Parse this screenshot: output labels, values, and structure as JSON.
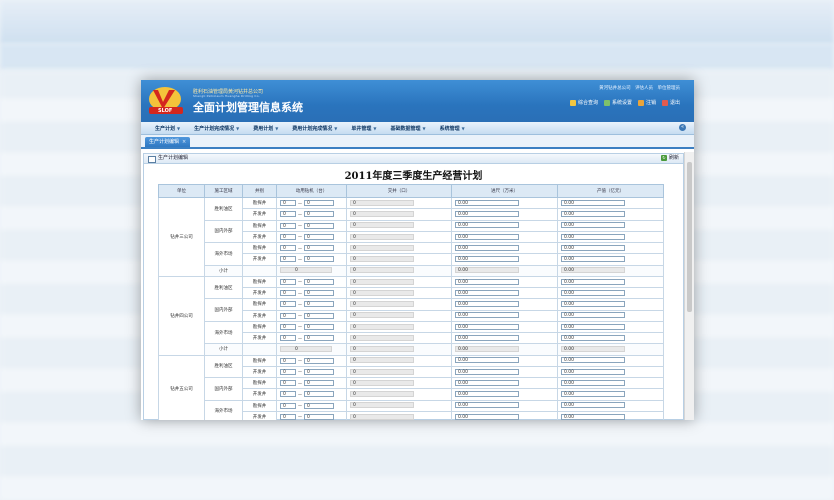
{
  "header": {
    "logo_text": "SLOF",
    "company_name": "胜利石油管理局黄河钻井总公司",
    "company_name_en": "Shengli Petroleum Huanghe Drilling Co.",
    "system_title": "全面计划管理信息系统",
    "user_info": [
      "黄河钻井总公司",
      "评估人员",
      "单位管理员"
    ],
    "tools": [
      {
        "label": "综合查询",
        "icon": "search-icon",
        "color": "#f2c640"
      },
      {
        "label": "系统设置",
        "icon": "gear-icon",
        "color": "#7ec16a"
      },
      {
        "label": "注销",
        "icon": "logout-icon",
        "color": "#e9a43a"
      },
      {
        "label": "退出",
        "icon": "exit-icon",
        "color": "#e25b4f"
      }
    ]
  },
  "nav": {
    "items": [
      "生产计划",
      "生产计划完成情况",
      "费用计划",
      "费用计划完成情况",
      "单井管理",
      "基础数据管理",
      "系统管理"
    ]
  },
  "tab": {
    "label": "生产计划编辑",
    "close": "×"
  },
  "panel": {
    "title": "生产计划编辑",
    "refresh_label": "刷新"
  },
  "report": {
    "title": "2011年度三季度生产经营计划",
    "columns": [
      "单位",
      "施工区域",
      "井别",
      "动用钻机（台）",
      "交井（口）",
      "进尺（万米）",
      "产值（亿元）"
    ],
    "units": [
      {
        "name": "钻井三公司",
        "areas": [
          {
            "name": "胜利油区",
            "rows": [
              {
                "type": "勘探井",
                "rig_min": "0",
                "rig_max": "0",
                "wells": "0",
                "footage": "0.00",
                "value": "0.00"
              },
              {
                "type": "开发井",
                "rig_min": "0",
                "rig_max": "0",
                "wells": "0",
                "footage": "0.00",
                "value": "0.00"
              }
            ]
          },
          {
            "name": "国内外部",
            "rows": [
              {
                "type": "勘探井",
                "rig_min": "0",
                "rig_max": "0",
                "wells": "0",
                "footage": "0.00",
                "value": "0.00"
              },
              {
                "type": "开发井",
                "rig_min": "0",
                "rig_max": "0",
                "wells": "0",
                "footage": "0.00",
                "value": "0.00"
              }
            ]
          },
          {
            "name": "海外市场",
            "rows": [
              {
                "type": "勘探井",
                "rig_min": "0",
                "rig_max": "0",
                "wells": "0",
                "footage": "0.00",
                "value": "0.00"
              },
              {
                "type": "开发井",
                "rig_min": "0",
                "rig_max": "0",
                "wells": "0",
                "footage": "0.00",
                "value": "0.00"
              }
            ]
          }
        ],
        "subtotal": {
          "label": "小计",
          "rigs": "0",
          "wells": "0",
          "footage": "0.00",
          "value": "0.00"
        }
      },
      {
        "name": "钻井四公司",
        "areas": [
          {
            "name": "胜利油区",
            "rows": [
              {
                "type": "勘探井",
                "rig_min": "0",
                "rig_max": "0",
                "wells": "0",
                "footage": "0.00",
                "value": "0.00"
              },
              {
                "type": "开发井",
                "rig_min": "0",
                "rig_max": "0",
                "wells": "0",
                "footage": "0.00",
                "value": "0.00"
              }
            ]
          },
          {
            "name": "国内外部",
            "rows": [
              {
                "type": "勘探井",
                "rig_min": "0",
                "rig_max": "0",
                "wells": "0",
                "footage": "0.00",
                "value": "0.00"
              },
              {
                "type": "开发井",
                "rig_min": "0",
                "rig_max": "0",
                "wells": "0",
                "footage": "0.00",
                "value": "0.00"
              }
            ]
          },
          {
            "name": "海外市场",
            "rows": [
              {
                "type": "勘探井",
                "rig_min": "0",
                "rig_max": "0",
                "wells": "0",
                "footage": "0.00",
                "value": "0.00"
              },
              {
                "type": "开发井",
                "rig_min": "0",
                "rig_max": "0",
                "wells": "0",
                "footage": "0.00",
                "value": "0.00"
              }
            ]
          }
        ],
        "subtotal": {
          "label": "小计",
          "rigs": "0",
          "wells": "0",
          "footage": "0.00",
          "value": "0.00"
        }
      },
      {
        "name": "钻井五公司",
        "areas": [
          {
            "name": "胜利油区",
            "rows": [
              {
                "type": "勘探井",
                "rig_min": "0",
                "rig_max": "0",
                "wells": "0",
                "footage": "0.00",
                "value": "0.00"
              },
              {
                "type": "开发井",
                "rig_min": "0",
                "rig_max": "0",
                "wells": "0",
                "footage": "0.00",
                "value": "0.00"
              }
            ]
          },
          {
            "name": "国内外部",
            "rows": [
              {
                "type": "勘探井",
                "rig_min": "0",
                "rig_max": "0",
                "wells": "0",
                "footage": "0.00",
                "value": "0.00"
              },
              {
                "type": "开发井",
                "rig_min": "0",
                "rig_max": "0",
                "wells": "0",
                "footage": "0.00",
                "value": "0.00"
              }
            ]
          },
          {
            "name": "海外市场",
            "rows": [
              {
                "type": "勘探井",
                "rig_min": "0",
                "rig_max": "0",
                "wells": "0",
                "footage": "0.00",
                "value": "0.00"
              },
              {
                "type": "开发井",
                "rig_min": "0",
                "rig_max": "0",
                "wells": "0",
                "footage": "0.00",
                "value": "0.00"
              }
            ]
          }
        ]
      }
    ]
  },
  "colors": {
    "header": "#2a74bd",
    "accent": "#3b7fc2",
    "table_header": "#dce9f5"
  }
}
